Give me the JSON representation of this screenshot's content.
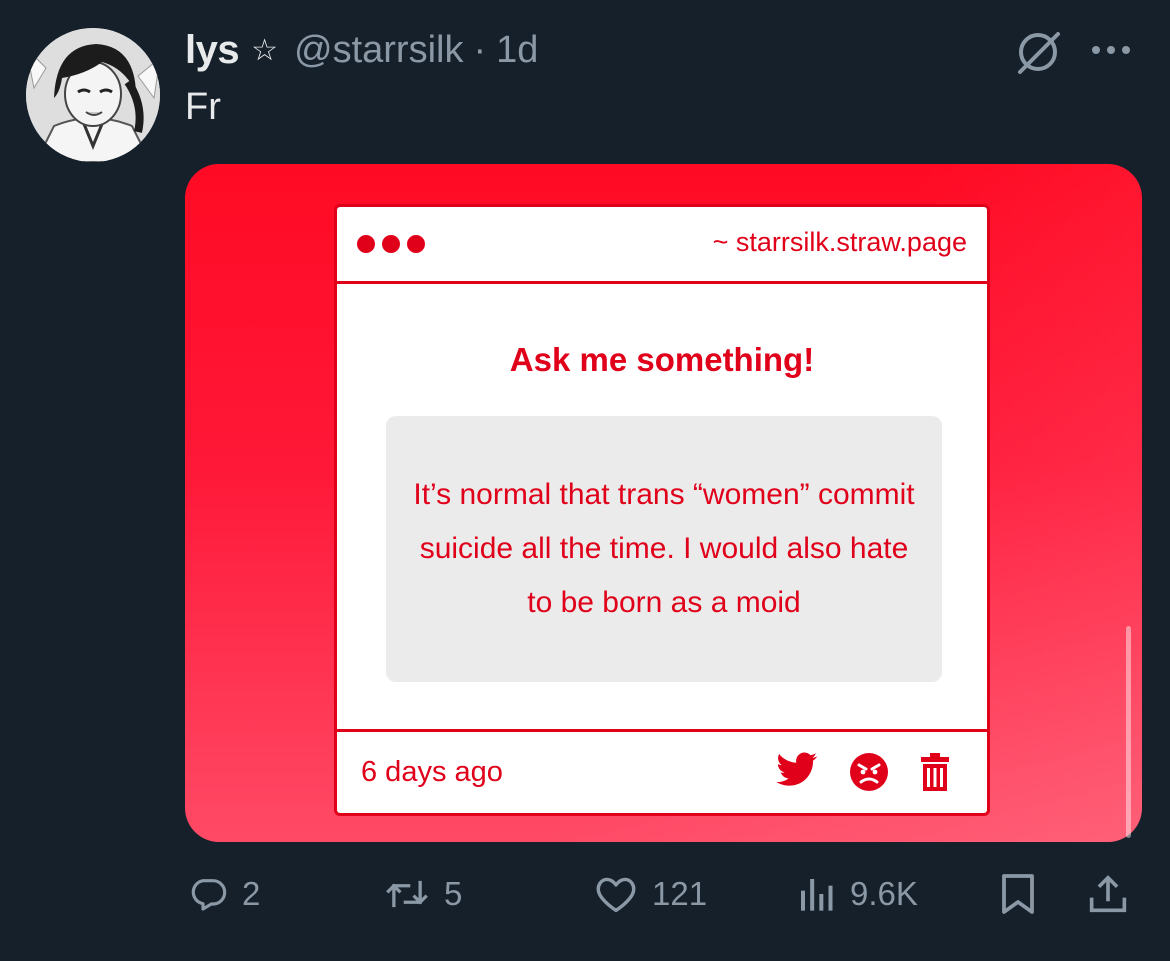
{
  "tweet": {
    "author_name": "lys",
    "star_glyph": "☆",
    "handle": "@starrsilk",
    "separator": "·",
    "age": "1d",
    "text": "Fr"
  },
  "header_icons": {
    "grok": "grok-icon",
    "more": "more-horizontal-icon"
  },
  "media_card": {
    "url": "~ starrsilk.straw.page",
    "title": "Ask me something!",
    "question": "It’s normal that trans “women” commit suicide all the time. I would also hate to be born as a moid",
    "timestamp": "6 days ago",
    "icons": [
      "twitter-bird-icon",
      "angry-face-icon",
      "trash-icon"
    ],
    "accent_color": "#e0001a"
  },
  "actions": {
    "replies": "2",
    "reposts": "5",
    "likes": "121",
    "views": "9.6K"
  },
  "colors": {
    "background": "#16202b",
    "muted_text": "#8b98a5",
    "primary_text": "#e7e9ea"
  }
}
